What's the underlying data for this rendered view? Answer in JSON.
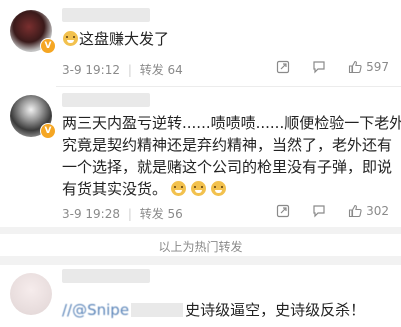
{
  "comments": [
    {
      "text": "这盘赚大发了",
      "time": "3-9 19:12",
      "repost_label": "转发",
      "repost_count": "64",
      "like_count": "597"
    },
    {
      "lines": [
        "两三天内盈亏逆转......啧啧啧......顺便检验一下老外",
        "究竟是契约精神还是弃约精神，当然了，老外还有",
        "一个选择，就是赌这个公司的枪里没有子弹，即说",
        "有货其实没货。"
      ],
      "time": "3-9 19:28",
      "repost_label": "转发",
      "repost_count": "56",
      "like_count": "302"
    },
    {
      "mention": "//@Snipe",
      "text": "史诗级逼空，史诗级反杀！"
    }
  ],
  "hot_separator": "以上为热门转发",
  "colors": {
    "badge": "#f5a623",
    "meta": "#8a8a8a",
    "link": "#5a84b8"
  }
}
